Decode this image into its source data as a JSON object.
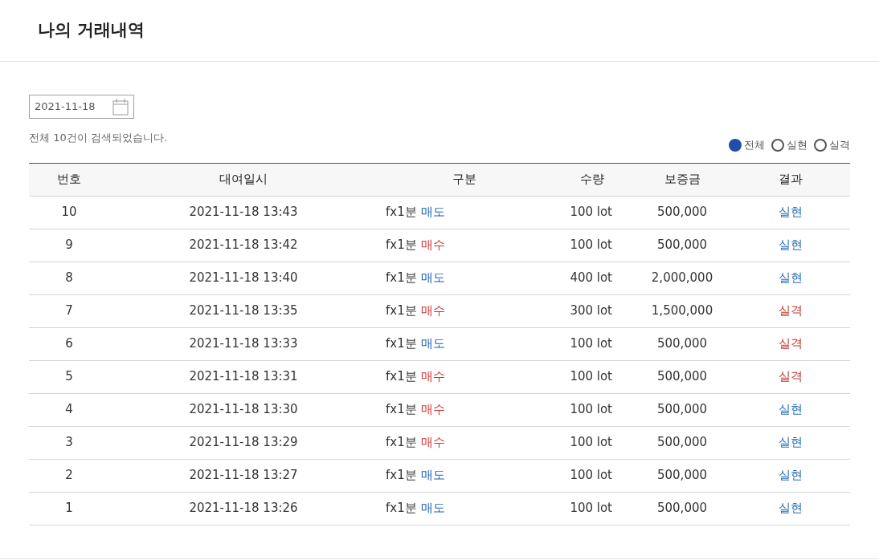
{
  "page_title": "나의 거래내역",
  "date_field": {
    "value": "2021-11-18"
  },
  "result_count": "전체 10건이 검색되었습니다.",
  "filters": [
    {
      "label": "전체",
      "selected": true
    },
    {
      "label": "실현",
      "selected": false
    },
    {
      "label": "실격",
      "selected": false
    }
  ],
  "table": {
    "columns": [
      "번호",
      "대여일시",
      "구분",
      "수량",
      "보증금",
      "결과"
    ],
    "rows": [
      {
        "no": "10",
        "datetime": "2021-11-18 13:43",
        "product": "fx1분",
        "side": {
          "label": "매도",
          "kind": "sell"
        },
        "quantity": "100 lot",
        "deposit": "500,000",
        "result": {
          "label": "실현",
          "kind": "realized"
        }
      },
      {
        "no": "9",
        "datetime": "2021-11-18 13:42",
        "product": "fx1분",
        "side": {
          "label": "매수",
          "kind": "buy"
        },
        "quantity": "100 lot",
        "deposit": "500,000",
        "result": {
          "label": "실현",
          "kind": "realized"
        }
      },
      {
        "no": "8",
        "datetime": "2021-11-18 13:40",
        "product": "fx1분",
        "side": {
          "label": "매도",
          "kind": "sell"
        },
        "quantity": "400 lot",
        "deposit": "2,000,000",
        "result": {
          "label": "실현",
          "kind": "realized"
        }
      },
      {
        "no": "7",
        "datetime": "2021-11-18 13:35",
        "product": "fx1분",
        "side": {
          "label": "매수",
          "kind": "buy"
        },
        "quantity": "300 lot",
        "deposit": "1,500,000",
        "result": {
          "label": "실격",
          "kind": "failed"
        }
      },
      {
        "no": "6",
        "datetime": "2021-11-18 13:33",
        "product": "fx1분",
        "side": {
          "label": "매도",
          "kind": "sell"
        },
        "quantity": "100 lot",
        "deposit": "500,000",
        "result": {
          "label": "실격",
          "kind": "failed"
        }
      },
      {
        "no": "5",
        "datetime": "2021-11-18 13:31",
        "product": "fx1분",
        "side": {
          "label": "매수",
          "kind": "buy"
        },
        "quantity": "100 lot",
        "deposit": "500,000",
        "result": {
          "label": "실격",
          "kind": "failed"
        }
      },
      {
        "no": "4",
        "datetime": "2021-11-18 13:30",
        "product": "fx1분",
        "side": {
          "label": "매수",
          "kind": "buy"
        },
        "quantity": "100 lot",
        "deposit": "500,000",
        "result": {
          "label": "실현",
          "kind": "realized"
        }
      },
      {
        "no": "3",
        "datetime": "2021-11-18 13:29",
        "product": "fx1분",
        "side": {
          "label": "매수",
          "kind": "buy"
        },
        "quantity": "100 lot",
        "deposit": "500,000",
        "result": {
          "label": "실현",
          "kind": "realized"
        }
      },
      {
        "no": "2",
        "datetime": "2021-11-18 13:27",
        "product": "fx1분",
        "side": {
          "label": "매도",
          "kind": "sell"
        },
        "quantity": "100 lot",
        "deposit": "500,000",
        "result": {
          "label": "실현",
          "kind": "realized"
        }
      },
      {
        "no": "1",
        "datetime": "2021-11-18 13:26",
        "product": "fx1분",
        "side": {
          "label": "매도",
          "kind": "sell"
        },
        "quantity": "100 lot",
        "deposit": "500,000",
        "result": {
          "label": "실현",
          "kind": "realized"
        }
      }
    ]
  }
}
